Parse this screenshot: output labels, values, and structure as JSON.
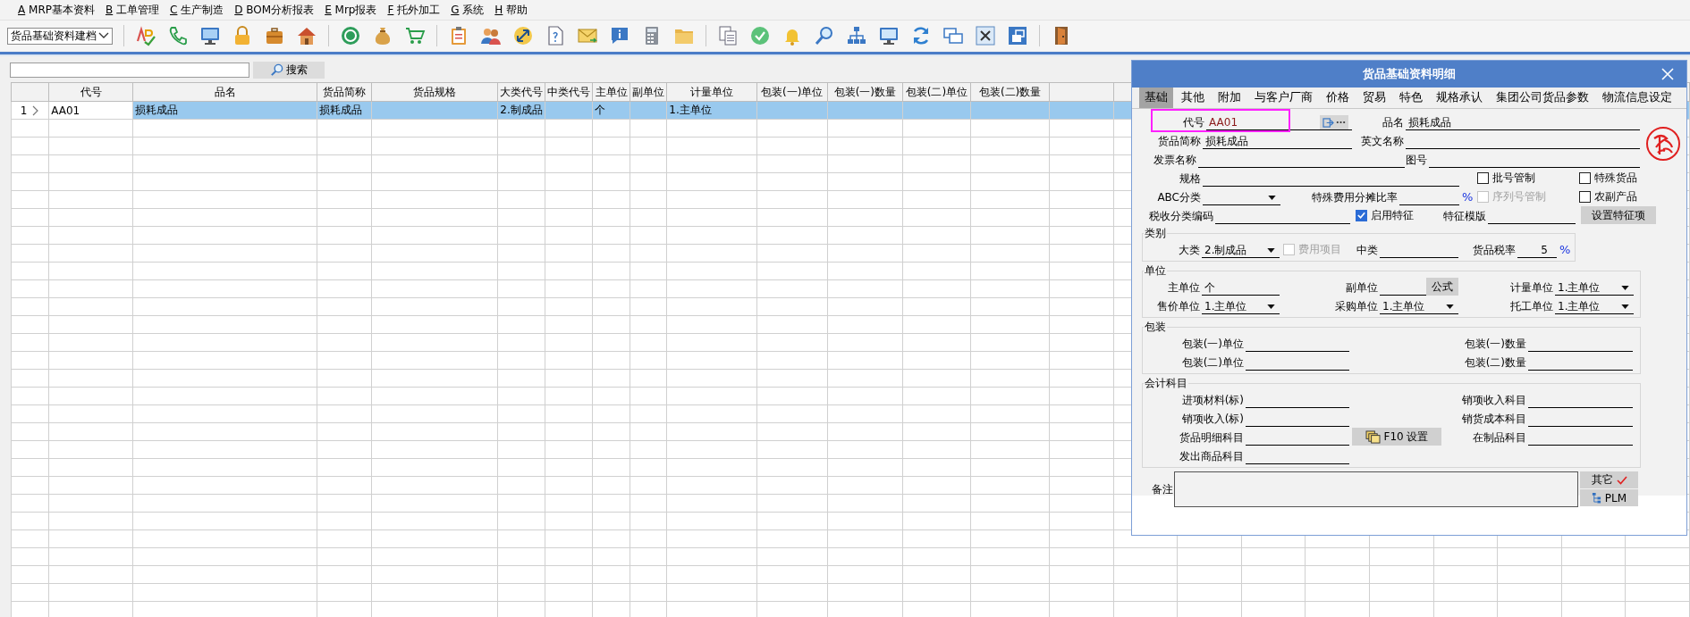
{
  "menu": [
    {
      "key": "A",
      "label": "MRP基本资料"
    },
    {
      "key": "B",
      "label": "工单管理"
    },
    {
      "key": "C",
      "label": "生产制造"
    },
    {
      "key": "D",
      "label": "BOM分析报表"
    },
    {
      "key": "E",
      "label": "Mrp报表"
    },
    {
      "key": "F",
      "label": "托外加工"
    },
    {
      "key": "G",
      "label": "系统"
    },
    {
      "key": "H",
      "label": "帮助"
    }
  ],
  "toolbar": {
    "module_select": "货品基础资料建档"
  },
  "search": {
    "button": "搜索"
  },
  "table": {
    "columns": [
      "代号",
      "品名",
      "货品简称",
      "货品规格",
      "大类代号",
      "中类代号",
      "主单位",
      "副单位",
      "计量单位",
      "包装(一)单位",
      "包装(一)数量",
      "包装(二)单位",
      "包装(二)数量"
    ],
    "rows": [
      {
        "number": "1",
        "selected": true,
        "code": "AA01",
        "name": "损耗成品",
        "short_name": "损耗成品",
        "category": "2.制成品",
        "main_unit": "个",
        "measure_unit": "1.主单位"
      }
    ]
  },
  "dialog": {
    "title": "货品基础资料明细",
    "tabs": [
      {
        "label": "基础",
        "selected": true
      },
      {
        "label": "其他",
        "selected": false
      },
      {
        "label": "附加",
        "selected": false
      },
      {
        "label": "与客户厂商",
        "selected": false
      },
      {
        "label": "价格",
        "selected": false
      },
      {
        "label": "贸易",
        "selected": false
      },
      {
        "label": "特色",
        "selected": false
      },
      {
        "label": "规格承认",
        "selected": false
      },
      {
        "label": "集团公司货品参数",
        "selected": false
      },
      {
        "label": "物流信息设定",
        "selected": false
      }
    ],
    "top_rows": [
      [
        {
          "kind": "field",
          "label": "代号",
          "value": "AA01"
        },
        {
          "kind": "field",
          "label": "品名",
          "value": "损耗成品"
        }
      ],
      [
        {
          "kind": "field",
          "label": "货品简称",
          "value": "损耗成品"
        },
        {
          "kind": "field",
          "label": "英文名称"
        }
      ],
      [
        {
          "kind": "field",
          "label": "发票名称"
        },
        {
          "kind": "field",
          "label": "图号"
        }
      ],
      [
        {
          "kind": "field",
          "label": "规格"
        },
        {
          "kind": "checkbox",
          "label": "批号管制",
          "checked": false,
          "disabled": false
        },
        {
          "kind": "checkbox",
          "label": "特殊货品",
          "checked": false,
          "disabled": false
        }
      ],
      [
        {
          "kind": "dropdown",
          "label": "ABC分类"
        },
        {
          "kind": "field",
          "label": "特殊费用分摊比率",
          "suffix": "%"
        },
        {
          "kind": "checkbox",
          "label": "序列号管制",
          "checked": false,
          "disabled": true
        },
        {
          "kind": "checkbox",
          "label": "农副产品",
          "checked": false,
          "disabled": false
        }
      ],
      [
        {
          "kind": "field",
          "label": "税收分类编码"
        },
        {
          "kind": "checkbox",
          "label": "启用特征",
          "checked": true,
          "disabled": false
        },
        {
          "kind": "field",
          "label": "特征模版"
        },
        {
          "kind": "button",
          "label": "设置特征项"
        }
      ]
    ],
    "groups": [
      {
        "title": "类别",
        "rows": [
          [
            {
              "kind": "dropdown",
              "label": "大类",
              "value": "2.制成品"
            },
            {
              "kind": "checkbox",
              "label": "费用项目",
              "checked": false,
              "disabled": true
            },
            {
              "kind": "field",
              "label": "中类"
            },
            {
              "kind": "field",
              "label": "货品税率",
              "value": "5",
              "suffix": "%"
            }
          ]
        ]
      },
      {
        "title": "单位",
        "rows": [
          [
            {
              "kind": "field",
              "label": "主单位",
              "value": "个"
            },
            {
              "kind": "field",
              "label": "副单位",
              "button": "公式"
            },
            {
              "kind": "dropdown",
              "label": "计量单位",
              "value": "1.主单位"
            }
          ],
          [
            {
              "kind": "dropdown",
              "label": "售价单位",
              "value": "1.主单位"
            },
            {
              "kind": "dropdown",
              "label": "采购单位",
              "value": "1.主单位"
            },
            {
              "kind": "dropdown",
              "label": "托工单位",
              "value": "1.主单位"
            }
          ]
        ]
      },
      {
        "title": "包装",
        "rows": [
          [
            {
              "kind": "field",
              "label": "包装(一)单位"
            },
            {
              "kind": "field",
              "label": "包装(一)数量"
            }
          ],
          [
            {
              "kind": "field",
              "label": "包装(二)单位"
            },
            {
              "kind": "field",
              "label": "包装(二)数量"
            }
          ]
        ]
      },
      {
        "title": "会计科目",
        "rows": [
          [
            {
              "kind": "field",
              "label": "进项材料(标)"
            },
            {
              "kind": "field",
              "label": "销项收入科目"
            }
          ],
          [
            {
              "kind": "field",
              "label": "销项收入(标)"
            },
            {
              "kind": "field",
              "label": "销货成本科目"
            }
          ],
          [
            {
              "kind": "field",
              "label": "货品明细科目"
            },
            {
              "kind": "button",
              "label": "F10 设置"
            },
            {
              "kind": "field",
              "label": "在制品科目"
            }
          ],
          [
            {
              "kind": "field",
              "label": "发出商品科目"
            }
          ]
        ]
      }
    ],
    "remark": {
      "label": "备注"
    },
    "side_buttons": [
      "其它",
      "PLM"
    ]
  }
}
